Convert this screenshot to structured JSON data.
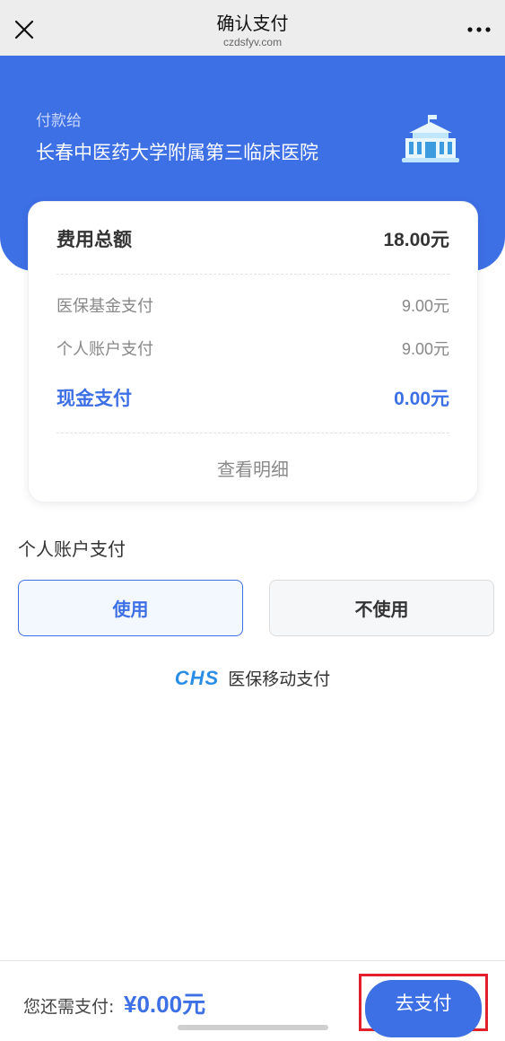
{
  "navbar": {
    "title": "确认支付",
    "domain": "czdsfyv.com",
    "close_icon": "close-icon",
    "more_icon": "more-icon"
  },
  "hero": {
    "pay_to_label": "付款给",
    "hospital_name": "长春中医药大学附属第三临床医院",
    "hospital_icon": "hospital-icon"
  },
  "summary": {
    "total_label": "费用总额",
    "total_value": "18.00元",
    "fund_label": "医保基金支付",
    "fund_value": "9.00元",
    "personal_label": "个人账户支付",
    "personal_value": "9.00元",
    "cash_label": "现金支付",
    "cash_value": "0.00元",
    "detail_link": "查看明细"
  },
  "account": {
    "section_label": "个人账户支付",
    "use_label": "使用",
    "not_use_label": "不使用",
    "selected": "使用"
  },
  "brand": {
    "logo_text": "CHS",
    "name": "医保移动支付"
  },
  "footer": {
    "remain_label": "您还需支付:",
    "remain_amount": "¥0.00元",
    "pay_button": "去支付"
  },
  "colors": {
    "primary": "#3d6fe5",
    "highlight_border": "#e0202a",
    "nav_bg": "#ededed"
  }
}
